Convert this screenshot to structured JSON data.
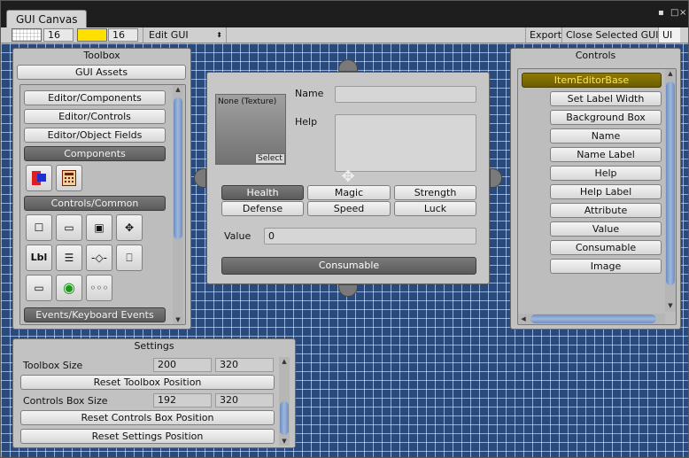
{
  "window": {
    "tab_title": "GUI Canvas"
  },
  "toolbar": {
    "grid_size": "16",
    "highlight_size": "16",
    "mode_dropdown": "Edit GUI",
    "export_label": "Export",
    "close_selected_label": "Close Selected GUI",
    "ui_label": "UI",
    "grid_color": "#ffffff",
    "highlight_color": "#ffe000"
  },
  "toolbox": {
    "title": "Toolbox",
    "assets_button": "GUI Assets",
    "editor_buttons": [
      "Editor/Components",
      "Editor/Controls",
      "Editor/Object Fields"
    ],
    "components_header": "Components",
    "controls_common_header": "Controls/Common",
    "events_header": "Events/Keyboard Events"
  },
  "item_editor": {
    "texture_caption": "None (Texture)",
    "texture_select": "Select",
    "name_label": "Name",
    "help_label": "Help",
    "attributes": [
      "Health",
      "Magic",
      "Strength",
      "Defense",
      "Speed",
      "Luck"
    ],
    "value_label": "Value",
    "value": "0",
    "consumable_button": "Consumable"
  },
  "controls": {
    "title": "Controls",
    "items": [
      "ItemEditorBase",
      "Set Label Width",
      "Background Box",
      "Name",
      "Name Label",
      "Help",
      "Help Label",
      "Attribute",
      "Value",
      "Consumable",
      "Image"
    ]
  },
  "settings": {
    "title": "Settings",
    "toolbox_size_label": "Toolbox Size",
    "toolbox_w": "200",
    "toolbox_h": "320",
    "reset_toolbox": "Reset Toolbox Position",
    "controls_size_label": "Controls Box Size",
    "controls_w": "192",
    "controls_h": "320",
    "reset_controls": "Reset Controls Box Position",
    "reset_settings": "Reset Settings Position"
  }
}
